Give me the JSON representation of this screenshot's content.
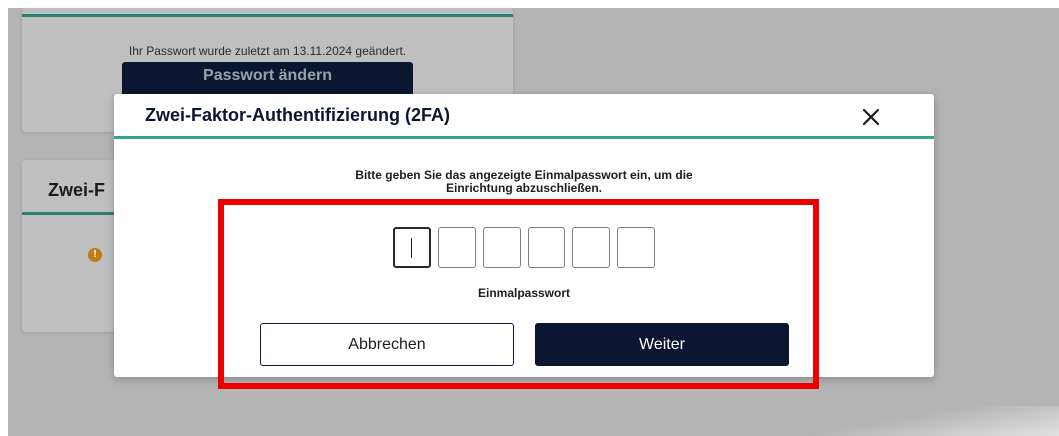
{
  "background": {
    "password_card": {
      "info_text": "Ihr Passwort wurde zuletzt am 13.11.2024 geändert.",
      "change_password_label": "Passwort ändern"
    },
    "twofa_card": {
      "title": "Zwei-F",
      "warning_icon": "exclamation-circle-icon"
    }
  },
  "modal": {
    "title": "Zwei-Faktor-Authentifizierung (2FA)",
    "close_icon": "close-icon",
    "instruction_line1": "Bitte geben Sie das angezeigte Einmalpasswort ein, um die",
    "instruction_line2": "Einrichtung abzuschließen.",
    "otp": {
      "digits": [
        "",
        "",
        "",
        "",
        "",
        ""
      ],
      "active_index": 0,
      "label": "Einmalpasswort"
    },
    "cancel_label": "Abbrechen",
    "next_label": "Weiter"
  },
  "colors": {
    "primary_navy": "#0b1730",
    "accent_teal": "#35a394",
    "highlight_red": "#ee0000",
    "warning_orange": "#c07a17"
  }
}
